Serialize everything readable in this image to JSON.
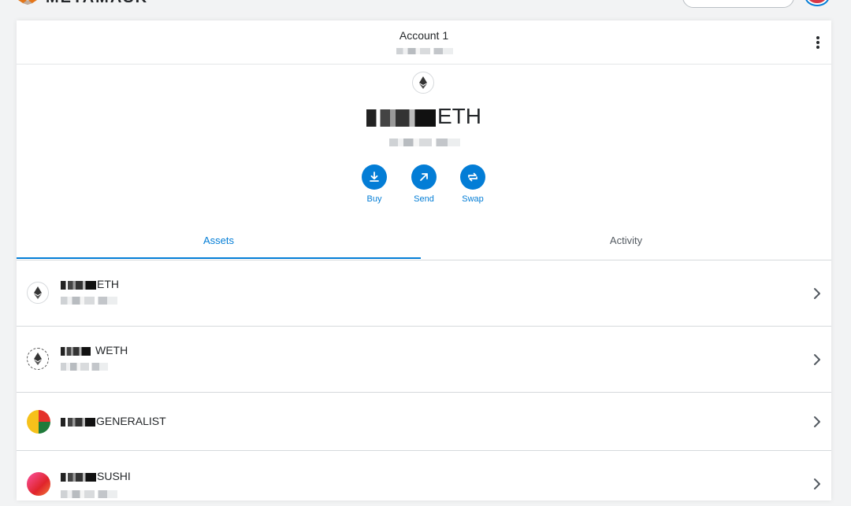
{
  "header": {
    "app_name": "METAMASK",
    "account_name": "Account 1"
  },
  "balance": {
    "symbol": "ETH"
  },
  "actions": [
    {
      "label": "Buy",
      "icon": "download-icon"
    },
    {
      "label": "Send",
      "icon": "arrow-up-right-icon"
    },
    {
      "label": "Swap",
      "icon": "swap-icon"
    }
  ],
  "tabs": [
    {
      "label": "Assets",
      "active": true
    },
    {
      "label": "Activity",
      "active": false
    }
  ],
  "assets": [
    {
      "symbol": "ETH",
      "icon": "eth-icon"
    },
    {
      "symbol": "WETH",
      "icon": "weth-icon"
    },
    {
      "symbol": "GENERALIST",
      "icon": "generalist-token-icon"
    },
    {
      "symbol": "SUSHI",
      "icon": "sushi-token-icon"
    }
  ],
  "colors": {
    "accent": "#037dd6",
    "text": "#24272a",
    "divider": "#d6d9dc",
    "background": "#f2f3f4"
  }
}
